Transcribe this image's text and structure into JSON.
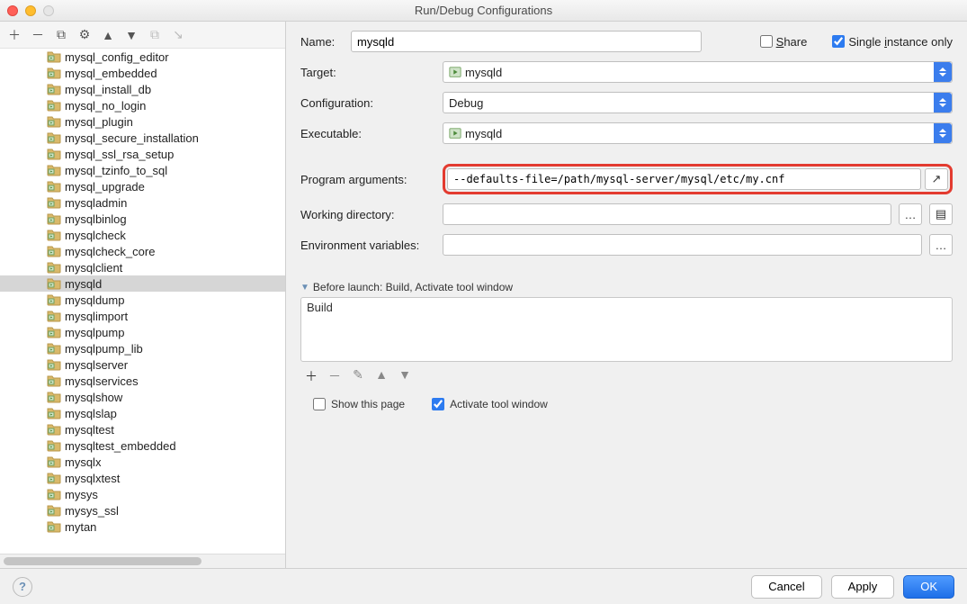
{
  "window": {
    "title": "Run/Debug Configurations"
  },
  "toolbar_icons": [
    "add",
    "remove",
    "copy",
    "settings",
    "up",
    "down",
    "save-defaults",
    "expand"
  ],
  "tree": {
    "items": [
      "mysql_config_editor",
      "mysql_embedded",
      "mysql_install_db",
      "mysql_no_login",
      "mysql_plugin",
      "mysql_secure_installation",
      "mysql_ssl_rsa_setup",
      "mysql_tzinfo_to_sql",
      "mysql_upgrade",
      "mysqladmin",
      "mysqlbinlog",
      "mysqlcheck",
      "mysqlcheck_core",
      "mysqlclient",
      "mysqld",
      "mysqldump",
      "mysqlimport",
      "mysqlpump",
      "mysqlpump_lib",
      "mysqlserver",
      "mysqlservices",
      "mysqlshow",
      "mysqlslap",
      "mysqltest",
      "mysqltest_embedded",
      "mysqlx",
      "mysqlxtest",
      "mysys",
      "mysys_ssl",
      "mytan"
    ],
    "selected": "mysqld"
  },
  "form": {
    "name_label": "Name:",
    "name_value": "mysqld",
    "share_label": "Share",
    "share_checked": false,
    "single_instance_label": "Single instance only",
    "single_instance_checked": true,
    "target_label": "Target:",
    "target_value": "mysqld",
    "configuration_label": "Configuration:",
    "configuration_value": "Debug",
    "executable_label": "Executable:",
    "executable_value": "mysqld",
    "program_arguments_label": "Program arguments:",
    "program_arguments_value": "--defaults-file=/path/mysql-server/mysql/etc/my.cnf",
    "working_directory_label": "Working directory:",
    "working_directory_value": "",
    "env_vars_label": "Environment variables:",
    "env_vars_value": ""
  },
  "before_launch": {
    "header": "Before launch: Build, Activate tool window",
    "items": [
      "Build"
    ],
    "show_this_page_label": "Show this page",
    "show_this_page_checked": false,
    "activate_tool_window_label": "Activate tool window",
    "activate_tool_window_checked": true
  },
  "buttons": {
    "cancel": "Cancel",
    "apply": "Apply",
    "ok": "OK"
  }
}
